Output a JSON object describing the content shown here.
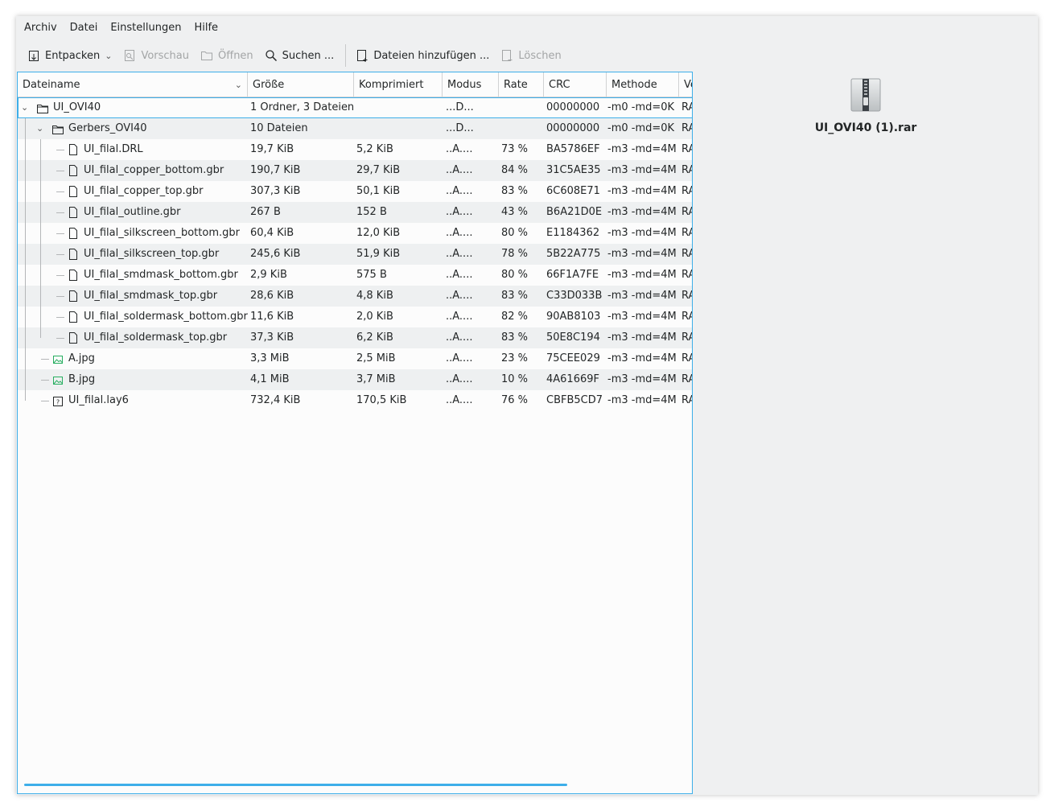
{
  "menu": [
    "Archiv",
    "Datei",
    "Einstellungen",
    "Hilfe"
  ],
  "toolbar": {
    "extract": "Entpacken",
    "preview": "Vorschau",
    "open": "Öffnen",
    "search": "Suchen ...",
    "add_files": "Dateien hinzufügen ...",
    "delete": "Löschen"
  },
  "columns": [
    "Dateiname",
    "Größe",
    "Komprimiert",
    "Modus",
    "Rate",
    "CRC",
    "Methode",
    "Version"
  ],
  "rows": [
    {
      "name": "UI_OVI40",
      "size": "1 Ordner, 3 Dateien",
      "compressed": "",
      "mode": "...D...",
      "rate": "",
      "crc": "00000000",
      "method": "-m0 -md=0K",
      "version": "RAR"
    },
    {
      "name": "Gerbers_OVI40",
      "size": "10 Dateien",
      "compressed": "",
      "mode": "...D...",
      "rate": "",
      "crc": "00000000",
      "method": "-m0 -md=0K",
      "version": "RAR"
    },
    {
      "name": "UI_filal.DRL",
      "size": "19,7 KiB",
      "compressed": "5,2 KiB",
      "mode": "..A....",
      "rate": "73 %",
      "crc": "BA5786EF",
      "method": "-m3 -md=4M",
      "version": "RAR"
    },
    {
      "name": "UI_filal_copper_bottom.gbr",
      "size": "190,7 KiB",
      "compressed": "29,7 KiB",
      "mode": "..A....",
      "rate": "84 %",
      "crc": "31C5AE35",
      "method": "-m3 -md=4M",
      "version": "RAR"
    },
    {
      "name": "UI_filal_copper_top.gbr",
      "size": "307,3 KiB",
      "compressed": "50,1 KiB",
      "mode": "..A....",
      "rate": "83 %",
      "crc": "6C608E71",
      "method": "-m3 -md=4M",
      "version": "RAR"
    },
    {
      "name": "UI_filal_outline.gbr",
      "size": "267 B",
      "compressed": "152 B",
      "mode": "..A....",
      "rate": "43 %",
      "crc": "B6A21D0E",
      "method": "-m3 -md=4M",
      "version": "RAR"
    },
    {
      "name": "UI_filal_silkscreen_bottom.gbr",
      "size": "60,4 KiB",
      "compressed": "12,0 KiB",
      "mode": "..A....",
      "rate": "80 %",
      "crc": "E1184362",
      "method": "-m3 -md=4M",
      "version": "RAR"
    },
    {
      "name": "UI_filal_silkscreen_top.gbr",
      "size": "245,6 KiB",
      "compressed": "51,9 KiB",
      "mode": "..A....",
      "rate": "78 %",
      "crc": "5B22A775",
      "method": "-m3 -md=4M",
      "version": "RAR"
    },
    {
      "name": "UI_filal_smdmask_bottom.gbr",
      "size": "2,9 KiB",
      "compressed": "575 B",
      "mode": "..A....",
      "rate": "80 %",
      "crc": "66F1A7FE",
      "method": "-m3 -md=4M",
      "version": "RAR"
    },
    {
      "name": "UI_filal_smdmask_top.gbr",
      "size": "28,6 KiB",
      "compressed": "4,8 KiB",
      "mode": "..A....",
      "rate": "83 %",
      "crc": "C33D033B",
      "method": "-m3 -md=4M",
      "version": "RAR"
    },
    {
      "name": "UI_filal_soldermask_bottom.gbr",
      "size": "11,6 KiB",
      "compressed": "2,0 KiB",
      "mode": "..A....",
      "rate": "82 %",
      "crc": "90AB8103",
      "method": "-m3 -md=4M",
      "version": "RAR"
    },
    {
      "name": "UI_filal_soldermask_top.gbr",
      "size": "37,3 KiB",
      "compressed": "6,2 KiB",
      "mode": "..A....",
      "rate": "83 %",
      "crc": "50E8C194",
      "method": "-m3 -md=4M",
      "version": "RAR"
    },
    {
      "name": "A.jpg",
      "size": "3,3 MiB",
      "compressed": "2,5 MiB",
      "mode": "..A....",
      "rate": "23 %",
      "crc": "75CEE029",
      "method": "-m3 -md=4M",
      "version": "RAR"
    },
    {
      "name": "B.jpg",
      "size": "4,1 MiB",
      "compressed": "3,7 MiB",
      "mode": "..A....",
      "rate": "10 %",
      "crc": "4A61669F",
      "method": "-m3 -md=4M",
      "version": "RAR"
    },
    {
      "name": "UI_filal.lay6",
      "size": "732,4 KiB",
      "compressed": "170,5 KiB",
      "mode": "..A....",
      "rate": "76 %",
      "crc": "CBFB5CD7",
      "method": "-m3 -md=4M",
      "version": "RAR"
    }
  ],
  "archive": {
    "name": "UI_OVI40 (1).rar",
    "icon": "zip-archive-icon"
  },
  "colors": {
    "accent": "#3daee9",
    "folder": "#232627",
    "image": "#27ae60"
  }
}
